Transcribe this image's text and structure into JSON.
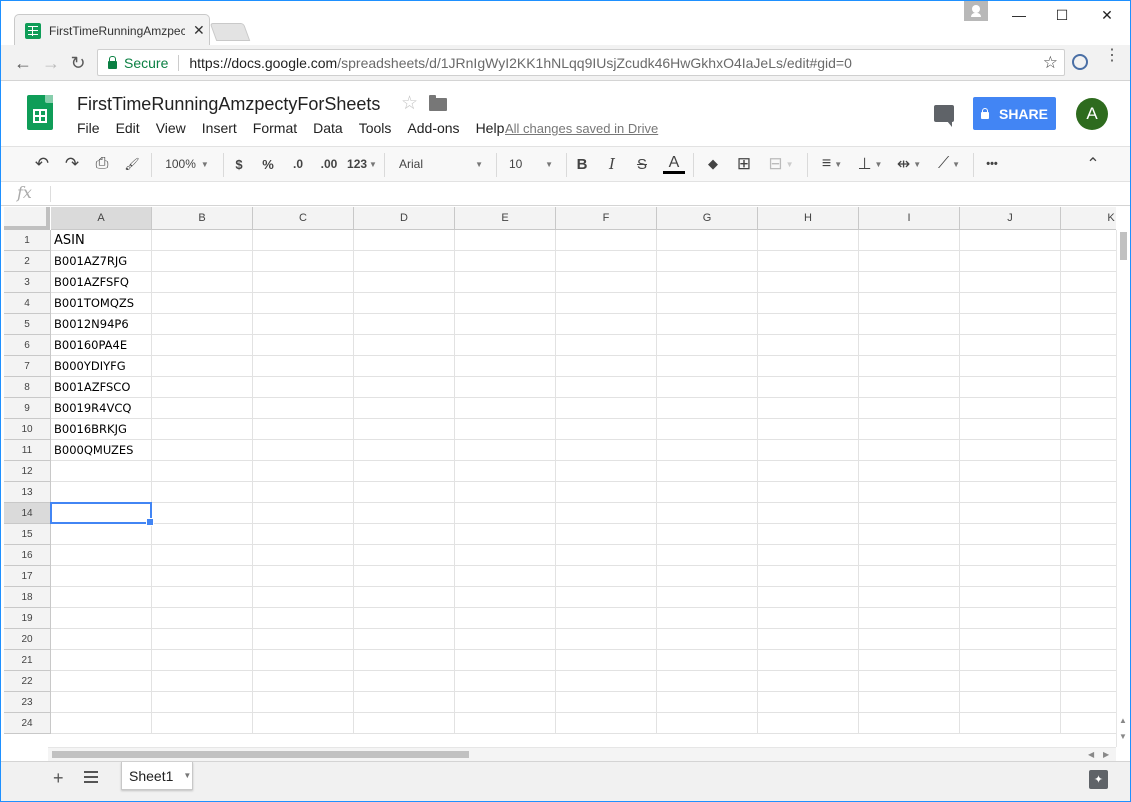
{
  "browser": {
    "tab_title": "FirstTimeRunningAmzpec",
    "tab_close": "✕",
    "url_secure_label": "Secure",
    "url_host": "https://docs.google.com",
    "url_path": "/spreadsheets/d/1JRnIgWyI2KK1hNLqq9IUsjZcudk46HwGkhxO4IaJeLs/edit#gid=0",
    "window_minimize": "—",
    "window_maximize": "☐",
    "window_close": "✕",
    "back": "←",
    "forward": "→",
    "reload": "↻",
    "bookmark": "☆",
    "menu": "⋮"
  },
  "doc": {
    "title": "FirstTimeRunningAmzpectyForSheets",
    "star": "☆",
    "menus": [
      "File",
      "Edit",
      "View",
      "Insert",
      "Format",
      "Data",
      "Tools",
      "Add-ons",
      "Help"
    ],
    "save_status": "All changes saved in Drive",
    "share_label": "SHARE",
    "avatar_initial": "A"
  },
  "toolbar": {
    "undo": "↶",
    "redo": "↷",
    "print": "⎙",
    "paint": "🖌",
    "zoom": "100%",
    "currency": "$",
    "percent": "%",
    "dec_decrease": ".0",
    "dec_increase": ".00",
    "more_formats": "123",
    "font": "Arial",
    "font_size": "10",
    "bold": "B",
    "italic": "I",
    "strike": "S",
    "text_color": "A",
    "fill": "◆",
    "borders": "⊞",
    "merge": "⊟",
    "align": "≡",
    "valign": "⊥",
    "wrap": "⇹",
    "rotate": "⟋",
    "more": "•••",
    "collapse": "⌃"
  },
  "formula_bar": {
    "fx": "fx",
    "value": ""
  },
  "sheet": {
    "columns": [
      "A",
      "B",
      "C",
      "D",
      "E",
      "F",
      "G",
      "H",
      "I",
      "J",
      "K"
    ],
    "rows": [
      "1",
      "2",
      "3",
      "4",
      "5",
      "6",
      "7",
      "8",
      "9",
      "10",
      "11",
      "12",
      "13",
      "14",
      "15",
      "16",
      "17",
      "18",
      "19",
      "20",
      "21",
      "22",
      "23",
      "24"
    ],
    "column_a_values": [
      "ASIN",
      "B001AZ7RJG",
      "B001AZFSFQ",
      "B001TOMQZS",
      "B0012N94P6",
      "B00160PA4E",
      "B000YDIYFG",
      "B001AZFSCO",
      "B0019R4VCQ",
      "B0016BRKJG",
      "B000QMUZES"
    ],
    "selected_cell": "A14",
    "selected_row": "14",
    "selected_column": "A"
  },
  "bottom": {
    "add_sheet": "+",
    "sheet_tab": "Sheet1",
    "explore": "✦"
  },
  "colors": {
    "accent_blue": "#4285f4",
    "sheets_green": "#0f9d58",
    "secure_green": "#0b8043",
    "avatar_green": "#2e6b1e"
  }
}
